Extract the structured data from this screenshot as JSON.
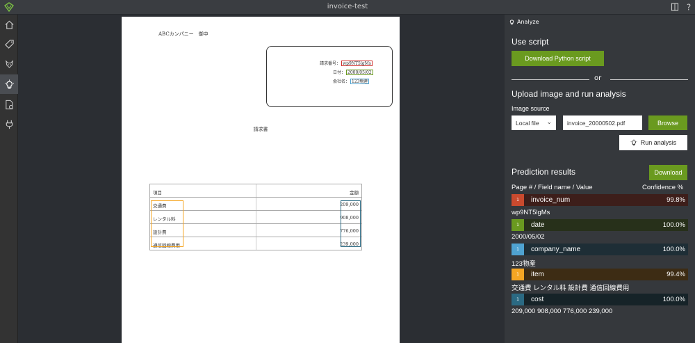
{
  "app": {
    "window_title": "invoice-test"
  },
  "nav": {
    "items": [
      {
        "icon": "home-icon"
      },
      {
        "icon": "tag-icon"
      },
      {
        "icon": "model-icon"
      },
      {
        "icon": "analyze-icon"
      },
      {
        "icon": "compose-icon"
      },
      {
        "icon": "plug-icon"
      }
    ],
    "active_index": 3
  },
  "document": {
    "addressee": "ABCカンパニー　御中",
    "fields": [
      {
        "key": "請求番号：",
        "value": "wp9NT5lgMs",
        "color": "#d0312d"
      },
      {
        "key": "日付：",
        "value": "2000/05/02",
        "color": "#6a9a1f"
      },
      {
        "key": "会社名：",
        "value": "123物産",
        "color": "#4fa3d1"
      }
    ],
    "title": "請求書",
    "table": {
      "headers": [
        "項目",
        "金額"
      ],
      "rows": [
        [
          "交通費",
          "209,000"
        ],
        [
          "レンタル料",
          "908,000"
        ],
        [
          "設計費",
          "776,000"
        ],
        [
          "通信回線費用",
          "239,000"
        ]
      ]
    }
  },
  "panel": {
    "header": "Analyze",
    "use_script": "Use script",
    "download_python": "Download Python script",
    "or": "or",
    "upload_heading": "Upload image and run analysis",
    "image_source_label": "Image source",
    "source_select": "Local file",
    "file_value": "invoice_20000502.pdf",
    "browse": "Browse",
    "run_analysis": "Run analysis",
    "prediction_heading": "Prediction results",
    "download": "Download",
    "col_left": "Page # / Field name / Value",
    "col_right": "Confidence %",
    "results": [
      {
        "page": "1",
        "name": "invoice_num",
        "confidence": "99.8%",
        "value": "wp9NT5lgMs",
        "badge_color": "#c94a2e",
        "row_color": "#3d1e1a"
      },
      {
        "page": "1",
        "name": "date",
        "confidence": "100.0%",
        "value": "2000/05/02",
        "badge_color": "#6a9a1f",
        "row_color": "#27301a"
      },
      {
        "page": "1",
        "name": "company_name",
        "confidence": "100.0%",
        "value": "123物産",
        "badge_color": "#4fa3d1",
        "row_color": "#1e2e36"
      },
      {
        "page": "1",
        "name": "item",
        "confidence": "99.4%",
        "value": "交通費 レンタル料 設計費 通信回線費用",
        "badge_color": "#f5a623",
        "row_color": "#3d2c14"
      },
      {
        "page": "1",
        "name": "cost",
        "confidence": "100.0%",
        "value": "209,000 908,000 776,000 239,000",
        "badge_color": "#2b6a83",
        "row_color": "#162328"
      }
    ]
  }
}
